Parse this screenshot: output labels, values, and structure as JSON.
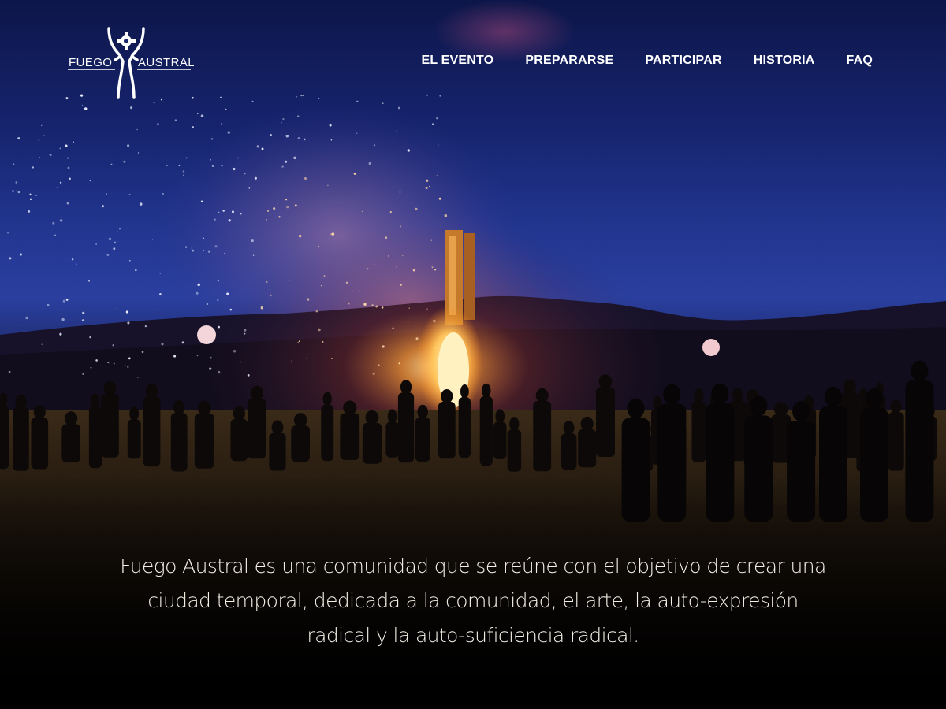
{
  "logo": {
    "word_left": "FUEGO",
    "word_right": "AUSTRAL",
    "alt": "Fuego Austral"
  },
  "nav": {
    "items": [
      {
        "label": "EL EVENTO"
      },
      {
        "label": "PREPARARSE"
      },
      {
        "label": "PARTICIPAR"
      },
      {
        "label": "HISTORIA"
      },
      {
        "label": "FAQ"
      }
    ]
  },
  "hero": {
    "tagline": "Fuego Austral es una comunidad que se reúne con el objetivo de crear una ciudad temporal, dedicada a la comunidad, el arte, la auto-expresión radical y la auto-suficiencia radical."
  },
  "colors": {
    "sky_top": "#0f1a55",
    "sky_mid": "#25379a",
    "fire": "#ffb648",
    "text": "#ffffff",
    "footer_bg": "#000000"
  }
}
